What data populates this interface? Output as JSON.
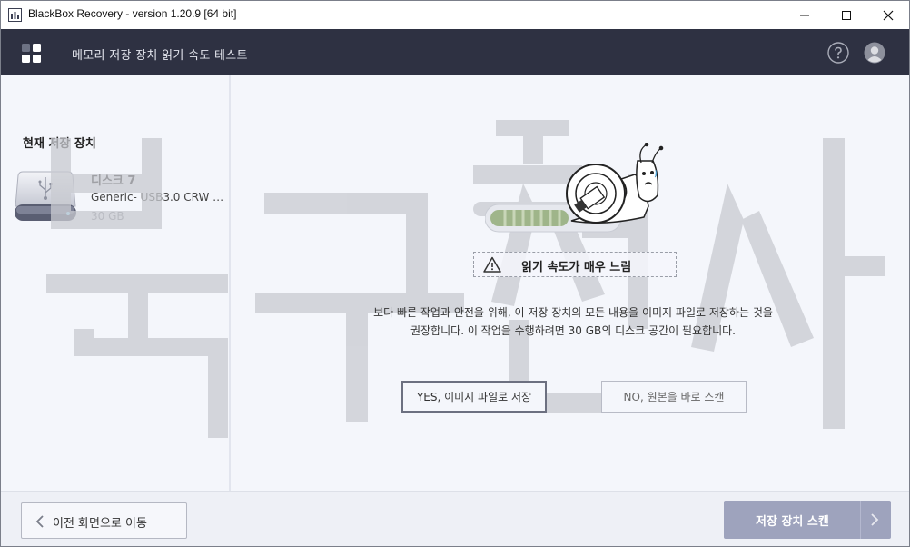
{
  "window": {
    "title": "BlackBox Recovery - version 1.20.9 [64 bit]"
  },
  "header": {
    "title": "메모리 저장 장치 읽기 속도 테스트",
    "help_icon": "help-circle-icon",
    "user_icon": "user-avatar-icon"
  },
  "sidebar": {
    "heading": "현재 저장 장치",
    "drive": {
      "name": "디스크 7",
      "model": "Generic- USB3.0 CRW …",
      "size": "30 GB",
      "icon": "usb-drive-icon"
    }
  },
  "main": {
    "warning": "읽기 속도가 매우 느림",
    "description_line1": "보다 빠른 작업과 안전을 위해, 이 저장 장치의 모든 내용을 이미지 파일로 저장하는 것을",
    "description_line2": "권장합니다. 이 작업을 수행하려면 30 GB의 디스크 공간이 필요합니다.",
    "yes_button": "YES, 이미지 파일로 저장",
    "no_button": "NO, 원본을 바로 스캔"
  },
  "footer": {
    "back_button": "이전 화면으로 이동",
    "scan_button": "저장 장치 스캔"
  },
  "watermark": {
    "text": "복구천사"
  },
  "colors": {
    "header_bg": "#2e3142",
    "content_bg": "#f4f6fb",
    "primary_button": "#9ea3bd",
    "watermark": "#c9cbd1"
  }
}
